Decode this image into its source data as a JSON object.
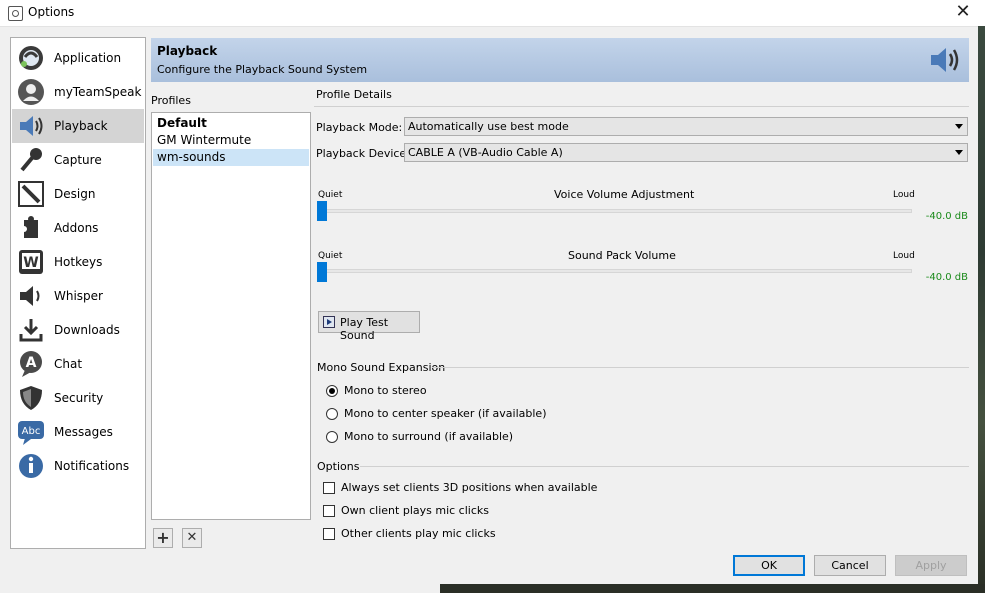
{
  "window": {
    "title": "Options",
    "close_glyph": "✕"
  },
  "sidebar": {
    "items": [
      {
        "label": "Application",
        "icon": "teamspeak-logo-icon"
      },
      {
        "label": "myTeamSpeak",
        "icon": "user-avatar-icon"
      },
      {
        "label": "Playback",
        "icon": "speaker-icon",
        "selected": true
      },
      {
        "label": "Capture",
        "icon": "microphone-icon"
      },
      {
        "label": "Design",
        "icon": "pencil-icon"
      },
      {
        "label": "Addons",
        "icon": "puzzle-piece-icon"
      },
      {
        "label": "Hotkeys",
        "icon": "keyboard-key-icon"
      },
      {
        "label": "Whisper",
        "icon": "speaker-whisper-icon"
      },
      {
        "label": "Downloads",
        "icon": "download-arrow-icon"
      },
      {
        "label": "Chat",
        "icon": "chat-bubble-icon"
      },
      {
        "label": "Security",
        "icon": "shield-icon"
      },
      {
        "label": "Messages",
        "icon": "abc-message-icon"
      },
      {
        "label": "Notifications",
        "icon": "info-icon"
      }
    ]
  },
  "header": {
    "title": "Playback",
    "subtitle": "Configure the Playback Sound System",
    "icon": "speaker-icon"
  },
  "profiles": {
    "label": "Profiles",
    "items": [
      {
        "name": "Default",
        "bold": true
      },
      {
        "name": "GM Wintermute"
      },
      {
        "name": "wm-sounds",
        "selected": true
      }
    ],
    "add_glyph": "+",
    "remove_glyph": "✕"
  },
  "details": {
    "label": "Profile Details",
    "playback_mode": {
      "label": "Playback Mode:",
      "value": "Automatically use best mode"
    },
    "playback_device": {
      "label": "Playback Device:",
      "value": "CABLE A (VB-Audio Cable A)"
    },
    "voice_volume": {
      "title": "Voice Volume Adjustment",
      "min_label": "Quiet",
      "max_label": "Loud",
      "value_text": "-40.0 dB",
      "level_percent": 0
    },
    "sound_pack_volume": {
      "title": "Sound Pack Volume",
      "min_label": "Quiet",
      "max_label": "Loud",
      "value_text": "-40.0 dB",
      "level_percent": 0
    },
    "test_button": "Play Test Sound"
  },
  "mono": {
    "title": "Mono Sound Expansion",
    "options": [
      {
        "label": "Mono to stereo",
        "checked": true
      },
      {
        "label": "Mono to center speaker (if available)",
        "checked": false
      },
      {
        "label": "Mono to surround (if available)",
        "checked": false
      }
    ]
  },
  "options": {
    "title": "Options",
    "checkboxes": [
      {
        "label": "Always set clients 3D positions when available",
        "checked": false
      },
      {
        "label": "Own client plays mic clicks",
        "checked": false
      },
      {
        "label": "Other clients play mic clicks",
        "checked": false
      }
    ]
  },
  "buttons": {
    "ok": "OK",
    "cancel": "Cancel",
    "apply": "Apply"
  }
}
